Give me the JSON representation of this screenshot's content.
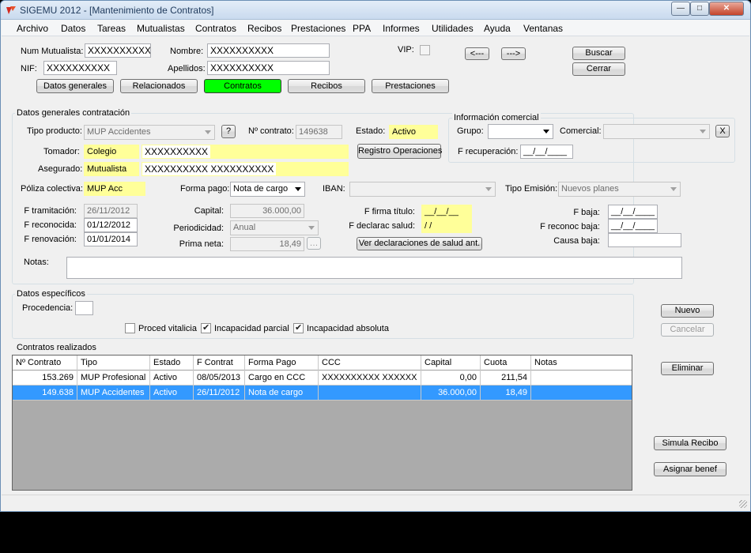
{
  "window": {
    "title": "SIGEMU 2012 - [Mantenimiento de Contratos]"
  },
  "menu": [
    "Archivo",
    "Datos",
    "Tareas",
    "Mutualistas",
    "Contratos",
    "Recibos",
    "Prestaciones",
    "PPA",
    "Informes",
    "Utilidades",
    "Ayuda",
    "Ventanas"
  ],
  "header": {
    "num_mutualista_label": "Num Mutualista:",
    "num_mutualista_value": "XXXXXXXXXX",
    "nombre_label": "Nombre:",
    "nombre_value": "XXXXXXXXXX",
    "vip_label": "VIP:",
    "nif_label": "NIF:",
    "nif_value": "XXXXXXXXXX",
    "apellidos_label": "Apellidos:",
    "apellidos_value": "XXXXXXXXXX",
    "prev_label": "<---",
    "next_label": "--->",
    "buscar_label": "Buscar",
    "cerrar_label": "Cerrar"
  },
  "tabs": [
    "Datos generales",
    "Relacionados",
    "Contratos",
    "Recibos",
    "Prestaciones"
  ],
  "contract": {
    "group_title": "Datos generales contratación",
    "tipo_producto_label": "Tipo producto:",
    "tipo_producto_value": "MUP Accidentes",
    "help_label": "?",
    "num_contrato_label": "Nº contrato:",
    "num_contrato_value": "149638",
    "estado_label": "Estado:",
    "estado_value": "Activo",
    "tomador_label": "Tomador:",
    "tomador_type": "Colegio",
    "tomador_value": "XXXXXXXXXX",
    "registro_label": "Registro Operaciones",
    "asegurado_label": "Asegurado:",
    "asegurado_type": "Mutualista",
    "asegurado_value": "XXXXXXXXXX XXXXXXXXXX",
    "poliza_label": "Póliza colectiva:",
    "poliza_value": "MUP Acc",
    "forma_pago_label": "Forma pago:",
    "forma_pago_value": "Nota de cargo",
    "iban_label": "IBAN:",
    "tipo_emision_label": "Tipo Emisión:",
    "tipo_emision_value": "Nuevos planes",
    "f_tramitacion_label": "F tramitación:",
    "f_tramitacion_value": "26/11/2012",
    "f_reconocida_label": "F reconocida:",
    "f_reconocida_value": "01/12/2012",
    "f_renovacion_label": "F renovación:",
    "f_renovacion_value": "01/01/2014",
    "capital_label": "Capital:",
    "capital_value": "36.000,00",
    "periodicidad_label": "Periodicidad:",
    "periodicidad_value": "Anual",
    "prima_neta_label": "Prima neta:",
    "prima_neta_value": "18,49",
    "f_firma_label": "F firma título:",
    "f_firma_value": "__/__/__",
    "f_declarac_label": "F declarac salud:",
    "f_declarac_value": "/ /",
    "ver_decl_label": "Ver declaraciones de salud ant.",
    "f_baja_label": "F baja:",
    "f_baja_value": "__/__/____",
    "f_reconoc_baja_label": "F reconoc baja:",
    "f_reconoc_baja_value": "__/__/____",
    "causa_baja_label": "Causa baja:",
    "notas_label": "Notas:"
  },
  "commercial": {
    "group_title": "Información comercial",
    "grupo_label": "Grupo:",
    "comercial_label": "Comercial:",
    "x_label": "X",
    "f_recuperacion_label": "F recuperación:",
    "f_recuperacion_value": "__/__/____"
  },
  "specific": {
    "group_title": "Datos específicos",
    "procedencia_label": "Procedencia:",
    "proced_vitalicia_label": "Proced vitalicia",
    "incap_parcial_label": "Incapacidad parcial",
    "incap_absoluta_label": "Incapacidad absoluta"
  },
  "contracts": {
    "group_title": "Contratos realizados",
    "columns": [
      "Nº Contrato",
      "Tipo",
      "Estado",
      "F Contrat",
      "Forma Pago",
      "CCC",
      "Capital",
      "Cuota",
      "Notas"
    ],
    "rows": [
      [
        "153.269",
        "MUP Profesional",
        "Activo",
        "08/05/2013",
        "Cargo en CCC",
        "XXXXXXXXXX XXXXXX",
        "0,00",
        "211,54",
        ""
      ],
      [
        "149.638",
        "MUP Accidentes",
        "Activo",
        "26/11/2012",
        "Nota de cargo",
        "",
        "36.000,00",
        "18,49",
        ""
      ]
    ]
  },
  "actions": {
    "nuevo_label": "Nuevo",
    "cancelar_label": "Cancelar",
    "eliminar_label": "Eliminar",
    "simula_label": "Simula Recibo",
    "asignar_label": "Asignar benef"
  },
  "colors": {
    "highlight": "#ffff99",
    "active_tab": "#00ff00",
    "selection": "#3399ff"
  },
  "checkbox_states": {
    "vip": false,
    "proced_vitalicia": false,
    "incap_parcial": true,
    "incap_absoluta": true
  }
}
